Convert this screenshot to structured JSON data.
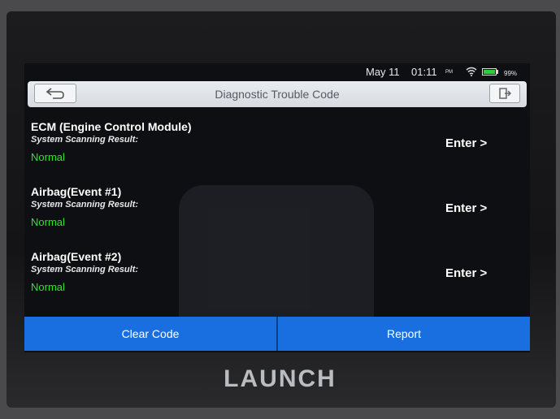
{
  "status_bar": {
    "date": "May 11",
    "time": "01:11",
    "ampm": "PM",
    "battery": "99%",
    "icons": [
      "wifi-icon",
      "battery-icon"
    ]
  },
  "header": {
    "title": "Diagnostic Trouble Code",
    "icons": [
      "back-arrow-icon",
      "exit-icon"
    ]
  },
  "systems": [
    {
      "name": "ECM (Engine Control Module)",
      "scan_label": "System Scanning Result:",
      "result": "Normal",
      "enter_label": "Enter >"
    },
    {
      "name": "Airbag(Event #1)",
      "scan_label": "System Scanning Result:",
      "result": "Normal",
      "enter_label": "Enter >"
    },
    {
      "name": "Airbag(Event #2)",
      "scan_label": "System Scanning Result:",
      "result": "Normal",
      "enter_label": "Enter >"
    }
  ],
  "footer": {
    "clear_label": "Clear Code",
    "report_label": "Report"
  },
  "brand": "LAUNCH",
  "colors": {
    "accent_blue": "#1a6fe0",
    "status_normal": "#2ee82e",
    "background": "#0d0f13"
  }
}
